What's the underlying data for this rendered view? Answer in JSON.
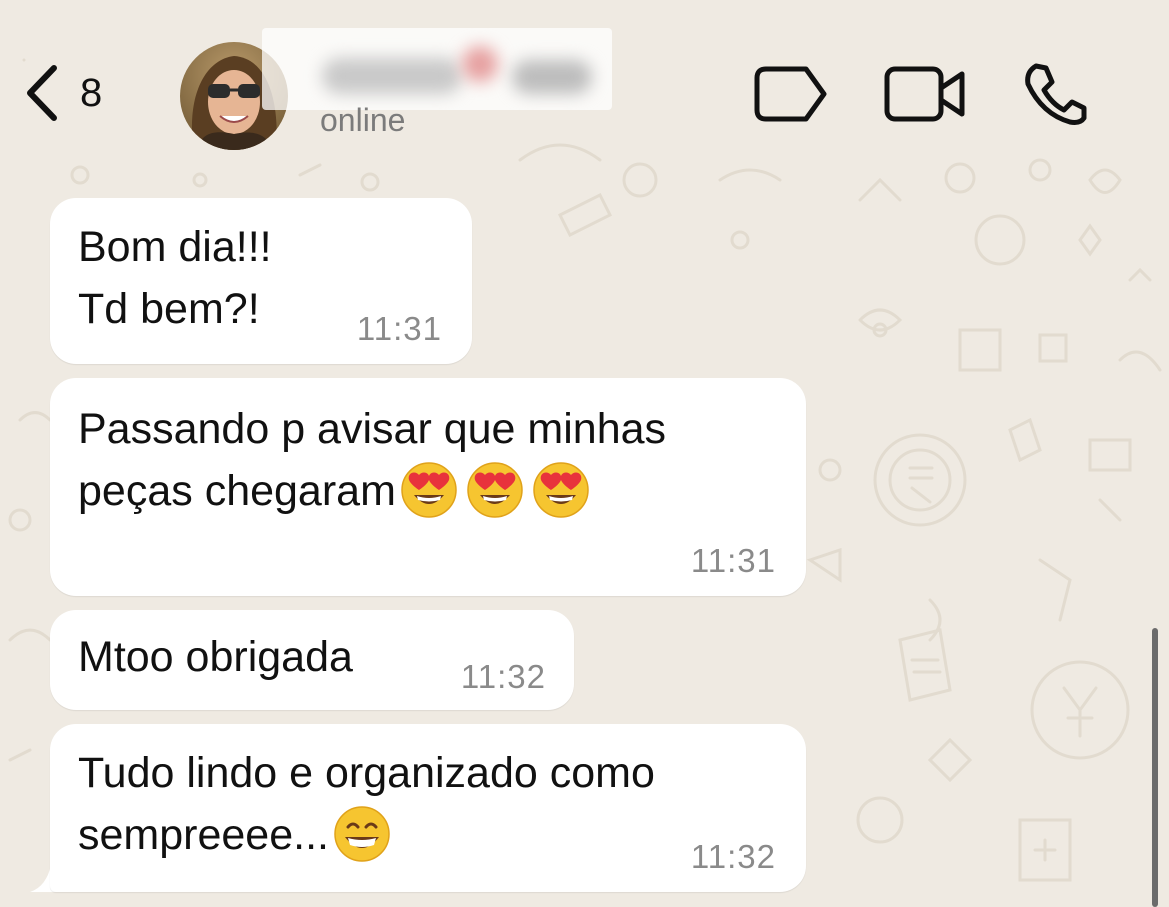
{
  "header": {
    "back_count": "8",
    "contact_name": "",
    "status": "online",
    "icons": [
      "chevron-left-icon",
      "label-tag-icon",
      "video-camera-icon",
      "phone-icon"
    ]
  },
  "messages": [
    {
      "lines": [
        "Bom dia!!!",
        "Td bem?!"
      ],
      "time": "11:31"
    },
    {
      "lines": [
        "Passando p avisar que minhas",
        "peças chegaram"
      ],
      "emojis": [
        "heart-eyes-emoji",
        "heart-eyes-emoji",
        "heart-eyes-emoji"
      ],
      "time": "11:31"
    },
    {
      "lines": [
        "Mtoo obrigada"
      ],
      "time": "11:32"
    },
    {
      "lines": [
        "Tudo lindo e organizado como",
        "sempreeee..."
      ],
      "emojis": [
        "grinning-emoji"
      ],
      "time": "11:32"
    }
  ],
  "colors": {
    "background": "#efeae2",
    "bubble": "#ffffff",
    "timestamp": "#8a8a8a",
    "status": "#7b7b7b"
  }
}
